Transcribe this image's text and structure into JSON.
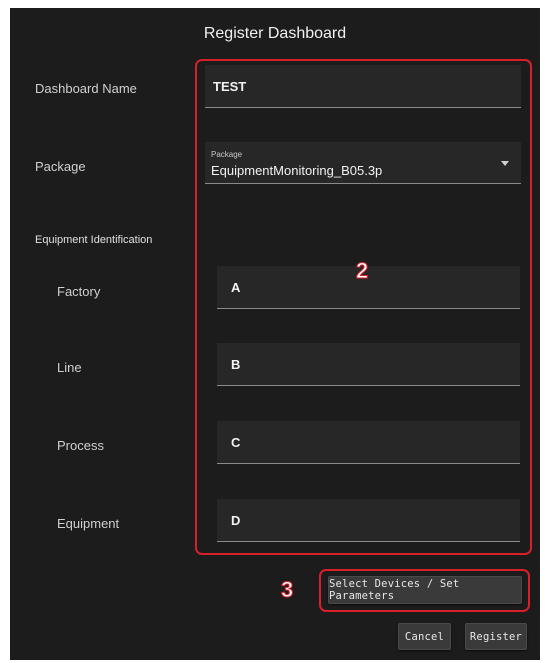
{
  "dialog": {
    "title": "Register Dashboard"
  },
  "form": {
    "dashboard_name": {
      "label": "Dashboard Name",
      "value": "TEST"
    },
    "package": {
      "label": "Package",
      "field_label": "Package",
      "value": "EquipmentMonitoring_B05.3p"
    },
    "equipment_identification": {
      "heading": "Equipment Identification",
      "factory": {
        "label": "Factory",
        "value": "A"
      },
      "line": {
        "label": "Line",
        "value": "B"
      },
      "process": {
        "label": "Process",
        "value": "C"
      },
      "equipment": {
        "label": "Equipment",
        "value": "D"
      }
    }
  },
  "annotations": {
    "fields_marker": "2",
    "select_button_marker": "3"
  },
  "buttons": {
    "select_devices": "Select Devices / Set Parameters",
    "cancel": "Cancel",
    "register": "Register"
  },
  "colors": {
    "background": "#1c1c1c",
    "field": "#272727",
    "annotation": "#d81f2a"
  }
}
